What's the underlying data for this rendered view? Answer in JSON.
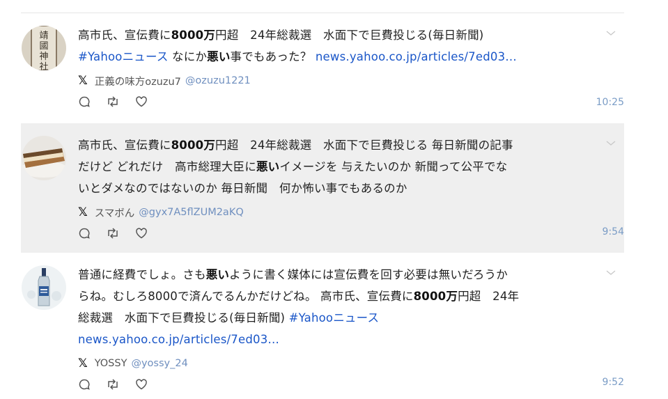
{
  "posts": [
    {
      "text_parts": [
        {
          "t": "高市氏、宣伝費に"
        },
        {
          "t": "8000万",
          "b": true
        },
        {
          "t": "円超　24年総裁選　水面下で巨費投じる(毎日新聞)"
        },
        {
          "br": true
        },
        {
          "t": "#Yahooニュース",
          "link": true
        },
        {
          "t": " なにか"
        },
        {
          "t": "悪い",
          "b": true
        },
        {
          "t": "事でもあった？ "
        },
        {
          "t": "news.yahoo.co.jp/articles/7ed03…",
          "link": true
        }
      ],
      "author": "正義の味方ozuzu7",
      "handle": "@ozuzu1221",
      "time": "10:25",
      "avatar": "shrine-plaque"
    },
    {
      "text_parts": [
        {
          "t": "高市氏、宣伝費に"
        },
        {
          "t": "8000万",
          "b": true
        },
        {
          "t": "円超　24年総裁選　水面下で巨費投じる 毎日新聞の記事"
        },
        {
          "br": true
        },
        {
          "t": "だけど どれだけ　高市総理大臣に"
        },
        {
          "t": "悪い",
          "b": true
        },
        {
          "t": "イメージを 与えたいのか 新聞って公平でな"
        },
        {
          "br": true
        },
        {
          "t": "いとダメなのではないのか 毎日新聞　何か怖い事でもあるのか"
        }
      ],
      "author": "スマボん",
      "handle": "@gyx7A5flZUM2aKQ",
      "time": "9:54",
      "avatar": "cake"
    },
    {
      "text_parts": [
        {
          "t": "普通に経費でしょ。さも"
        },
        {
          "t": "悪い",
          "b": true
        },
        {
          "t": "ように書く媒体には宣伝費を回す必要は無いだろうか"
        },
        {
          "br": true
        },
        {
          "t": "らね。むしろ8000で済んでるんかだけどね。 高市氏、宣伝費に"
        },
        {
          "t": "8000万",
          "b": true
        },
        {
          "t": "円超　24年"
        },
        {
          "br": true
        },
        {
          "t": "総裁選　水面下で巨費投じる(毎日新聞) "
        },
        {
          "t": "#Yahooニュース",
          "link": true
        },
        {
          "br": true
        },
        {
          "t": "news.yahoo.co.jp/articles/7ed03…",
          "link": true
        }
      ],
      "author": "YOSSY",
      "handle": "@yossy_24",
      "time": "9:52",
      "avatar": "bottle"
    }
  ],
  "icons": {
    "source": "x-logo",
    "reply": "reply-icon",
    "retweet": "retweet-icon",
    "like": "like-icon",
    "menu": "chevron-down-icon"
  },
  "colors": {
    "link": "#1a56c8",
    "handle": "#6f8fbf",
    "time": "#7a9cc6",
    "highlight_bg": "#efefef"
  }
}
